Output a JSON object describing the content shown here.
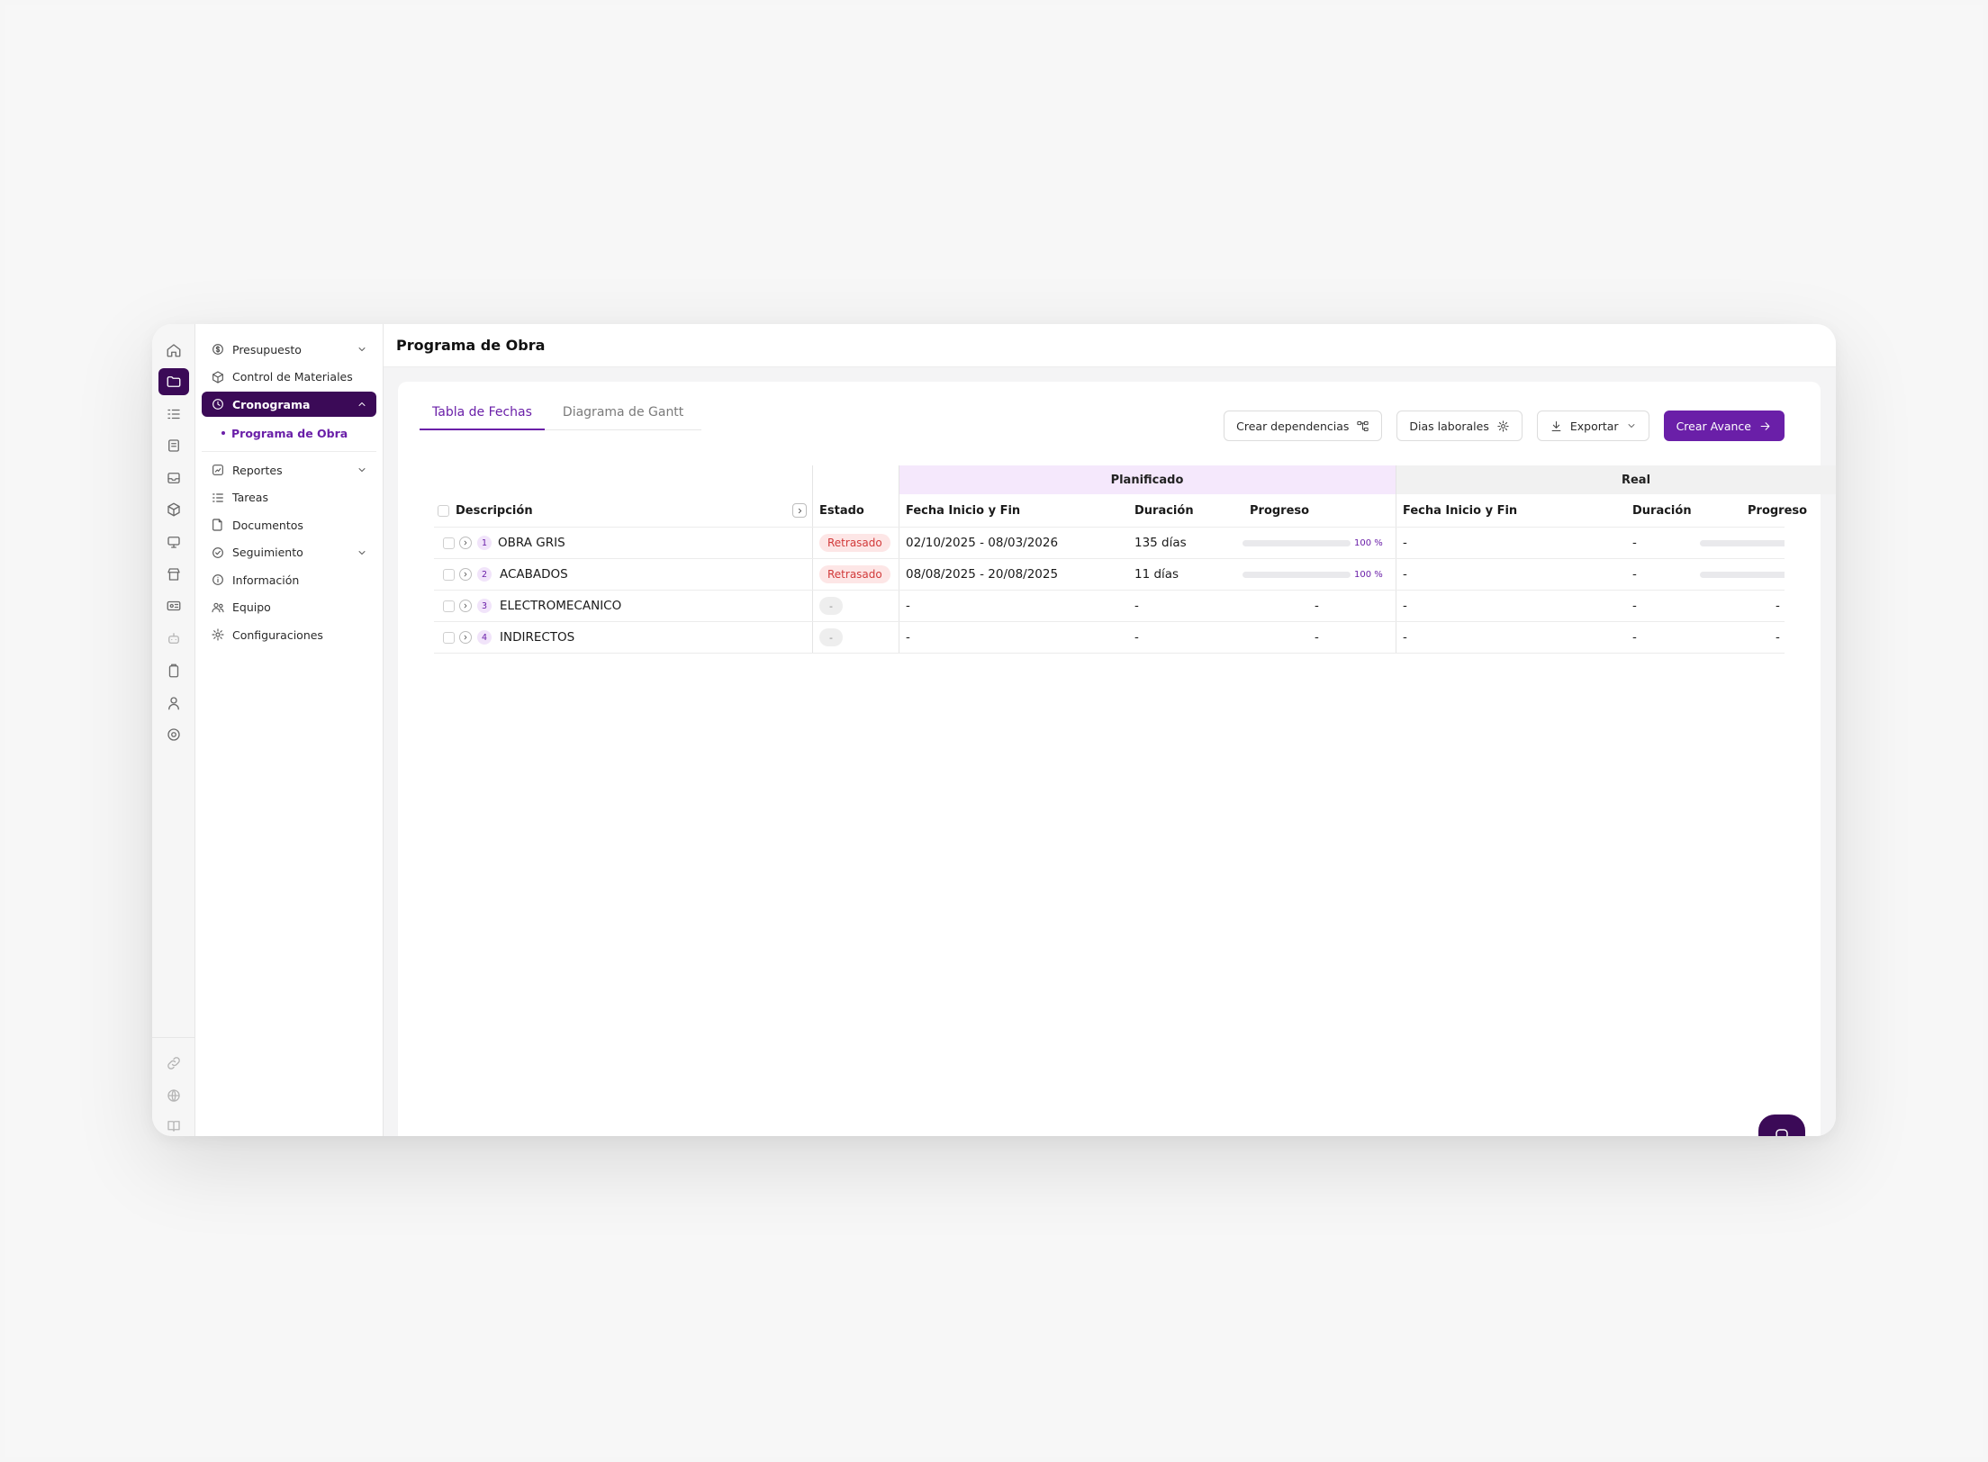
{
  "page": {
    "title": "Programa de Obra"
  },
  "sidebar": {
    "items": [
      {
        "label": "Presupuesto",
        "icon": "dollar-circle-icon",
        "expandable": true
      },
      {
        "label": "Control de Materiales",
        "icon": "box-icon",
        "expandable": false
      },
      {
        "label": "Cronograma",
        "icon": "clock-icon",
        "expandable": true,
        "active": true
      },
      {
        "label": "Reportes",
        "icon": "chart-icon",
        "expandable": true
      },
      {
        "label": "Tareas",
        "icon": "list-icon",
        "expandable": false
      },
      {
        "label": "Documentos",
        "icon": "folder-icon",
        "expandable": false
      },
      {
        "label": "Seguimiento",
        "icon": "check-circle-icon",
        "expandable": true
      },
      {
        "label": "Información",
        "icon": "info-icon",
        "expandable": false
      },
      {
        "label": "Equipo",
        "icon": "users-icon",
        "expandable": false
      },
      {
        "label": "Configuraciones",
        "icon": "gear-icon",
        "expandable": false
      }
    ],
    "sub_item": "Programa de Obra"
  },
  "tabs": [
    {
      "label": "Tabla de Fechas",
      "active": true
    },
    {
      "label": "Diagrama de Gantt",
      "active": false
    }
  ],
  "toolbar": {
    "dependencies": "Crear dependencias",
    "workdays": "Dias laborales",
    "export": "Exportar",
    "create": "Crear Avance"
  },
  "table": {
    "groups": {
      "planned": "Planificado",
      "real": "Real"
    },
    "headers": {
      "description": "Descripción",
      "status": "Estado",
      "plan_dates": "Fecha Inicio y Fin",
      "plan_duration": "Duración",
      "plan_progress": "Progreso",
      "real_dates": "Fecha Inicio y Fin",
      "real_duration": "Duración",
      "real_progress": "Progreso"
    },
    "rows": [
      {
        "num": "1",
        "description": "OBRA GRIS",
        "status": "Retrasado",
        "plan_dates": "02/10/2025 - 08/03/2026",
        "plan_duration": "135 días",
        "plan_progress": 100,
        "plan_progress_label": "100 %",
        "real_dates": "-",
        "real_duration": "-",
        "real_progress": ""
      },
      {
        "num": "2",
        "description": "ACABADOS",
        "status": "Retrasado",
        "plan_dates": "08/08/2025 - 20/08/2025",
        "plan_duration": "11 días",
        "plan_progress": 100,
        "plan_progress_label": "100 %",
        "real_dates": "-",
        "real_duration": "-",
        "real_progress": ""
      },
      {
        "num": "3",
        "description": "ELECTROMECANICO",
        "status": "-",
        "plan_dates": "-",
        "plan_duration": "-",
        "plan_progress_label": "-",
        "real_dates": "-",
        "real_duration": "-",
        "real_progress": "-"
      },
      {
        "num": "4",
        "description": "INDIRECTOS",
        "status": "-",
        "plan_dates": "-",
        "plan_duration": "-",
        "plan_progress_label": "-",
        "real_dates": "-",
        "real_duration": "-",
        "real_progress": "-"
      }
    ]
  },
  "colors": {
    "brand_dark": "#3b0a57",
    "brand": "#6a1fa8",
    "late_bg": "#fde6e6",
    "late_text": "#d23a3a",
    "planned_bg": "#f5e8fc"
  }
}
